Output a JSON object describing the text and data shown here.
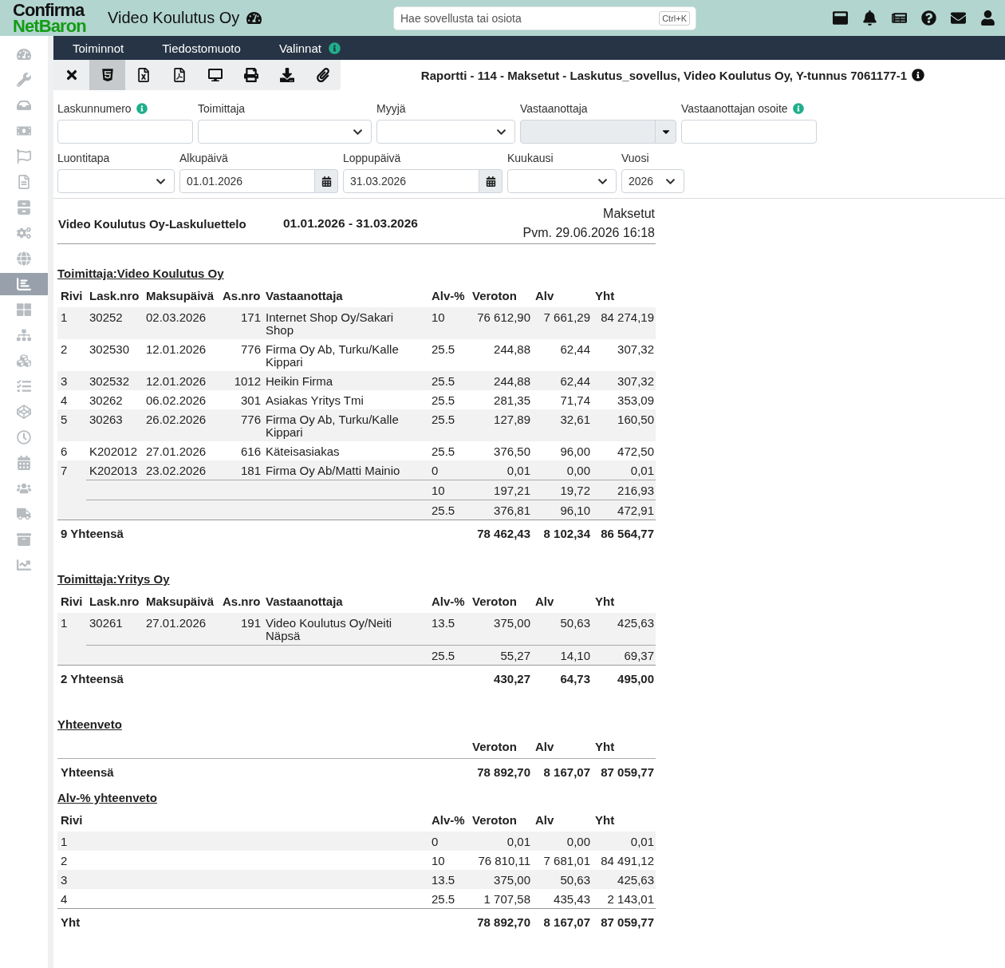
{
  "header": {
    "logo": {
      "top": "Confirma",
      "bottom": "NetBaron"
    },
    "company": "Video Koulutus Oy",
    "search": {
      "placeholder": "Hae sovellusta tai osiota",
      "shortcut": "Ctrl+K"
    }
  },
  "sidebar": {
    "items": [
      {
        "selected": false
      },
      {
        "selected": false
      },
      {
        "selected": false
      },
      {
        "selected": false
      },
      {
        "selected": false
      },
      {
        "selected": false
      },
      {
        "selected": false
      },
      {
        "selected": false
      },
      {
        "selected": false
      },
      {
        "selected": true
      },
      {
        "selected": false
      },
      {
        "selected": false
      },
      {
        "selected": false
      },
      {
        "selected": false
      },
      {
        "selected": false
      },
      {
        "selected": false
      },
      {
        "selected": false
      },
      {
        "selected": false
      },
      {
        "selected": false
      },
      {
        "selected": false
      },
      {
        "selected": false
      }
    ]
  },
  "menu": [
    {
      "label": "Toiminnot",
      "info": false
    },
    {
      "label": "Tiedostomuoto",
      "info": false
    },
    {
      "label": "Valinnat",
      "info": true
    }
  ],
  "toolbar": {
    "buttons": [
      {
        "selected": false
      },
      {
        "selected": true
      },
      {
        "selected": false
      },
      {
        "selected": false
      },
      {
        "selected": false
      },
      {
        "selected": false
      },
      {
        "selected": false
      },
      {
        "selected": false
      }
    ],
    "title": "Raportti - 114 - Maksetut - Laskutus_sovellus, Video Koulutus Oy, Y-tunnus 7061177-1"
  },
  "filters": [
    [
      {
        "label": "Laskunnumero",
        "info": true,
        "kind": "text",
        "disabled": false
      },
      {
        "label": "Toimittaja",
        "info": false,
        "kind": "select",
        "disabled": false
      },
      {
        "label": "Myyjä",
        "info": false,
        "kind": "select",
        "disabled": false
      },
      {
        "label": "Vastaanottaja",
        "info": false,
        "kind": "combo",
        "disabled": true
      },
      {
        "label": "Vastaanottajan osoite",
        "info": true,
        "kind": "text",
        "disabled": false
      }
    ],
    [
      {
        "label": "Luontitapa",
        "info": false,
        "kind": "select",
        "disabled": false
      },
      {
        "label": "Alkupäivä",
        "info": false,
        "kind": "date",
        "value": "01.01.2026",
        "disabled": false
      },
      {
        "label": "Loppupäivä",
        "info": false,
        "kind": "date",
        "value": "31.03.2026",
        "disabled": false
      },
      {
        "label": "Kuukausi",
        "info": false,
        "kind": "select",
        "disabled": false
      },
      {
        "label": "Vuosi",
        "info": false,
        "kind": "select",
        "value": "2026",
        "disabled": false
      }
    ]
  ],
  "report": {
    "title": "Video Koulutus Oy-Laskuluettelo",
    "period": "01.01.2026 - 31.03.2026",
    "status": "Maksetut",
    "printed": "Pvm. 29.06.2026 16:18",
    "groups": [
      {
        "heading": "Toimittaja:Video Koulutus Oy",
        "columns": [
          "Rivi",
          "Lask.nro",
          "Maksupäivä",
          "As.nro",
          "Vastaanottaja",
          "Alv-%",
          "Veroton",
          "Alv",
          "Yht"
        ],
        "rows": [
          [
            "1",
            "30252",
            "02.03.2026",
            "171",
            "Internet Shop Oy/Sakari Shop",
            "10",
            "76 612,90",
            "7 661,29",
            "84 274,19"
          ],
          [
            "2",
            "302530",
            "12.01.2026",
            "776",
            "Firma Oy Ab, Turku/Kalle Kippari",
            "25.5",
            "244,88",
            "62,44",
            "307,32"
          ],
          [
            "3",
            "302532",
            "12.01.2026",
            "1012",
            "Heikin Firma",
            "25.5",
            "244,88",
            "62,44",
            "307,32"
          ],
          [
            "4",
            "30262",
            "06.02.2026",
            "301",
            "Asiakas Yritys Tmi",
            "25.5",
            "281,35",
            "71,74",
            "353,09"
          ],
          [
            "5",
            "30263",
            "26.02.2026",
            "776",
            "Firma Oy Ab, Turku/Kalle Kippari",
            "25.5",
            "127,89",
            "32,61",
            "160,50"
          ],
          [
            "6",
            "K202012",
            "27.01.2026",
            "616",
            "Käteisasiakas",
            "25.5",
            "376,50",
            "96,00",
            "472,50"
          ],
          [
            "7",
            "K202013",
            "23.02.2026",
            "181",
            "Firma Oy Ab/Matti Mainio",
            "0",
            "0,01",
            "0,00",
            "0,01"
          ]
        ],
        "subtotals": [
          [
            "10",
            "197,21",
            "19,72",
            "216,93"
          ],
          [
            "25.5",
            "376,81",
            "96,10",
            "472,91"
          ]
        ],
        "total": {
          "label": "9 Yhteensä",
          "values": [
            "78 462,43",
            "8 102,34",
            "86 564,77"
          ]
        }
      },
      {
        "heading": "Toimittaja:Yritys Oy",
        "columns": [
          "Rivi",
          "Lask.nro",
          "Maksupäivä",
          "As.nro",
          "Vastaanottaja",
          "Alv-%",
          "Veroton",
          "Alv",
          "Yht"
        ],
        "rows": [
          [
            "1",
            "30261",
            "27.01.2026",
            "191",
            "Video Koulutus Oy/Neiti Näpsä",
            "13.5",
            "375,00",
            "50,63",
            "425,63"
          ]
        ],
        "subtotals": [
          [
            "25.5",
            "55,27",
            "14,10",
            "69,37"
          ]
        ],
        "total": {
          "label": "2 Yhteensä",
          "values": [
            "430,27",
            "64,73",
            "495,00"
          ]
        }
      }
    ],
    "summary": {
      "heading": "Yhteenveto",
      "columns": [
        "Veroton",
        "Alv",
        "Yht"
      ],
      "total": {
        "label": "Yhteensä",
        "values": [
          "78 892,70",
          "8 167,07",
          "87 059,77"
        ]
      }
    },
    "vat_summary": {
      "heading": "Alv-% yhteenveto",
      "columns": [
        "Rivi",
        "Alv-%",
        "Veroton",
        "Alv",
        "Yht"
      ],
      "rows": [
        [
          "1",
          "0",
          "0,01",
          "0,00",
          "0,01"
        ],
        [
          "2",
          "10",
          "76 810,11",
          "7 681,01",
          "84 491,12"
        ],
        [
          "3",
          "13.5",
          "375,00",
          "50,63",
          "425,63"
        ],
        [
          "4",
          "25.5",
          "1 707,58",
          "435,43",
          "2 143,01"
        ]
      ],
      "total": {
        "label": "Yht",
        "values": [
          "78 892,70",
          "8 167,07",
          "87 059,77"
        ]
      }
    }
  }
}
